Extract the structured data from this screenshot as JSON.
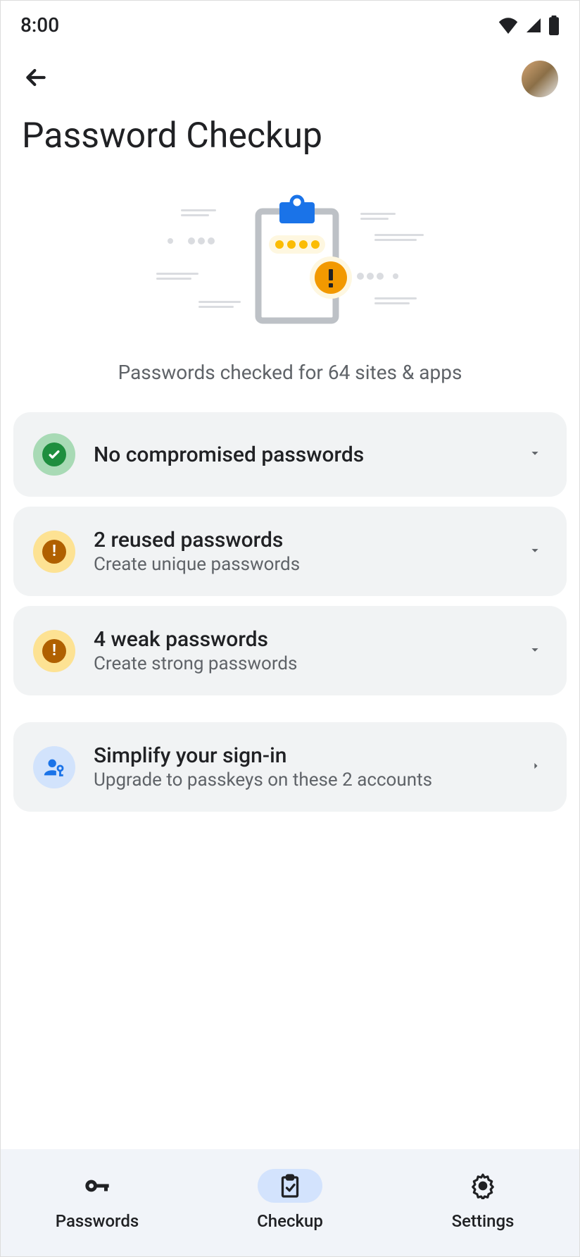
{
  "status": {
    "time": "8:00"
  },
  "page": {
    "title": "Password Checkup",
    "subtitle": "Passwords checked for 64 sites & apps"
  },
  "cards": [
    {
      "title": "No compromised passwords",
      "subtitle": ""
    },
    {
      "title": "2 reused passwords",
      "subtitle": "Create unique passwords"
    },
    {
      "title": "4 weak passwords",
      "subtitle": "Create strong passwords"
    }
  ],
  "passkey": {
    "title": "Simplify your sign-in",
    "subtitle": "Upgrade to passkeys on these 2 accounts"
  },
  "nav": {
    "passwords": "Passwords",
    "checkup": "Checkup",
    "settings": "Settings"
  }
}
